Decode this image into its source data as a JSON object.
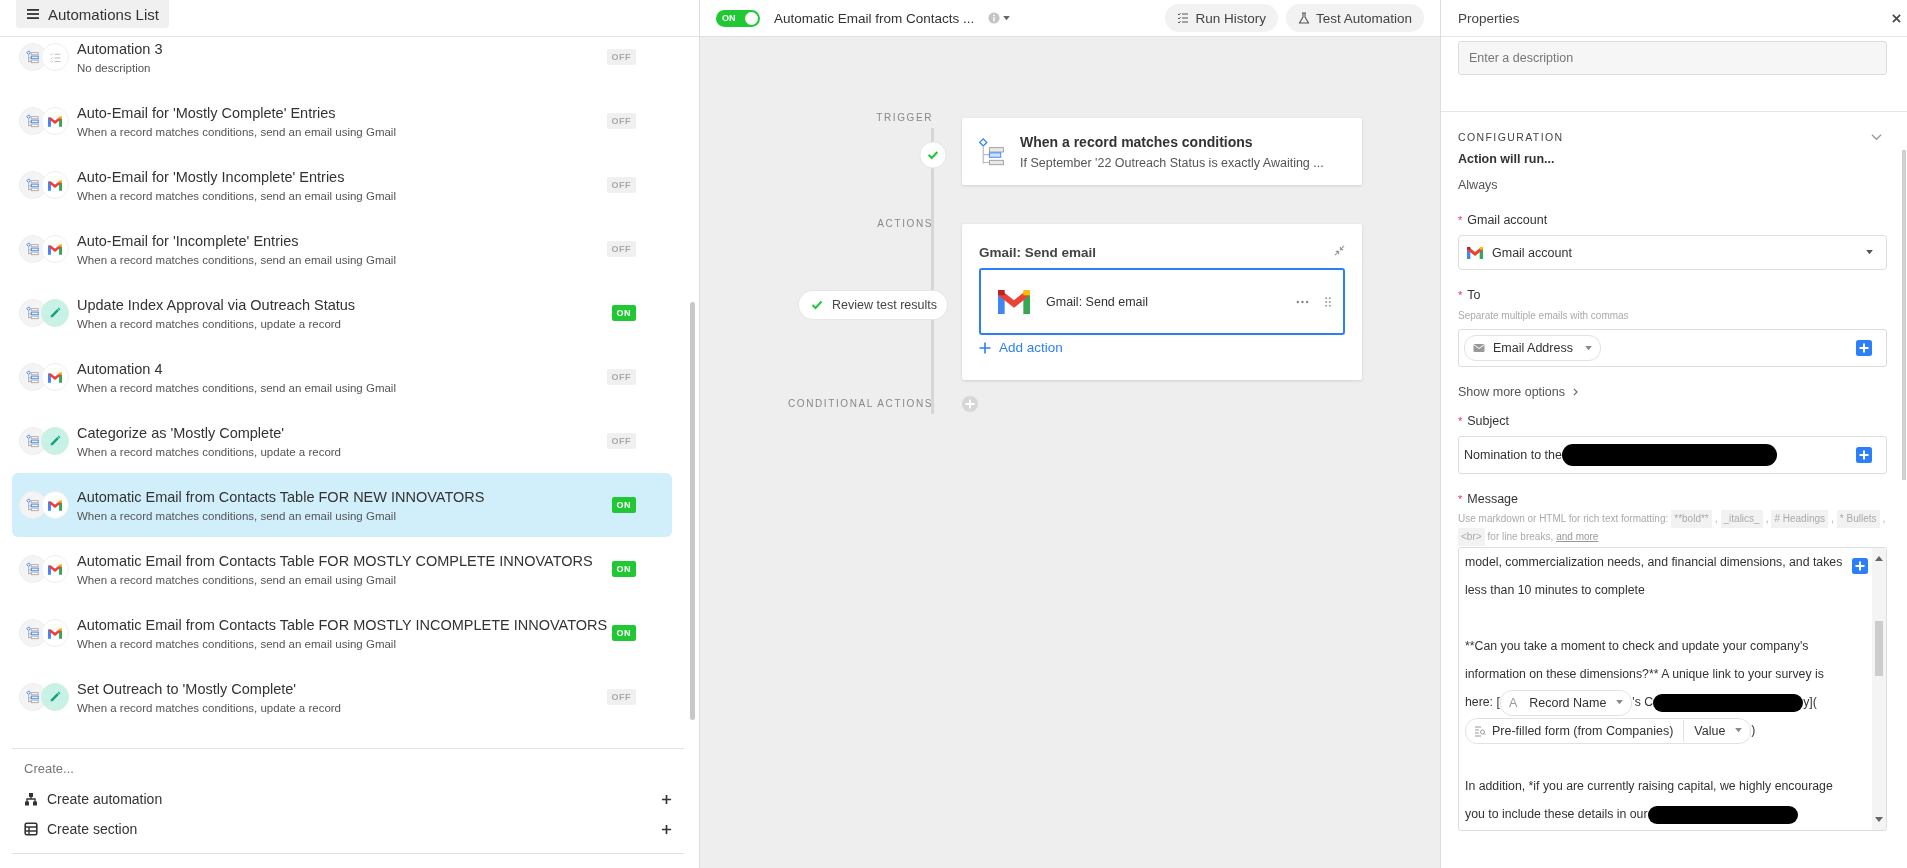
{
  "list_panel": {
    "title": "Automations List",
    "automations": [
      {
        "name": "Automation 3",
        "description": "No description",
        "kind": "none",
        "status": "OFF",
        "on": false,
        "selected": false
      },
      {
        "name": "Auto-Email for 'Mostly Complete' Entries",
        "description": "When a record matches conditions, send an email using Gmail",
        "kind": "gmail",
        "status": "OFF",
        "on": false,
        "selected": false
      },
      {
        "name": "Auto-Email for 'Mostly Incomplete' Entries",
        "description": "When a record matches conditions, send an email using Gmail",
        "kind": "gmail",
        "status": "OFF",
        "on": false,
        "selected": false
      },
      {
        "name": "Auto-Email for 'Incomplete' Entries",
        "description": "When a record matches conditions, send an email using Gmail",
        "kind": "gmail",
        "status": "OFF",
        "on": false,
        "selected": false
      },
      {
        "name": "Update Index Approval via Outreach Status",
        "description": "When a record matches conditions, update a record",
        "kind": "update",
        "status": "ON",
        "on": true,
        "selected": false
      },
      {
        "name": "Automation 4",
        "description": "When a record matches conditions, send an email using Gmail",
        "kind": "gmail",
        "status": "OFF",
        "on": false,
        "selected": false
      },
      {
        "name": "Categorize as 'Mostly Complete'",
        "description": "When a record matches conditions, update a record",
        "kind": "update",
        "status": "OFF",
        "on": false,
        "selected": false
      },
      {
        "name": "Automatic Email from Contacts Table FOR NEW INNOVATORS",
        "description": "When a record matches conditions, send an email using Gmail",
        "kind": "gmail",
        "status": "ON",
        "on": true,
        "selected": true
      },
      {
        "name": "Automatic Email from Contacts Table FOR MOSTLY COMPLETE INNOVATORS",
        "description": "When a record matches conditions, send an email using Gmail",
        "kind": "gmail",
        "status": "ON",
        "on": true,
        "selected": false
      },
      {
        "name": "Automatic Email from Contacts Table FOR MOSTLY INCOMPLETE INNOVATORS",
        "description": "When a record matches conditions, send an email using Gmail",
        "kind": "gmail",
        "status": "ON",
        "on": true,
        "selected": false
      },
      {
        "name": "Set Outreach to 'Mostly Complete'",
        "description": "When a record matches conditions, update a record",
        "kind": "update",
        "status": "OFF",
        "on": false,
        "selected": false
      }
    ],
    "create": {
      "heading": "Create...",
      "items": [
        {
          "kind": "automation",
          "label": "Create automation"
        },
        {
          "kind": "section",
          "label": "Create section"
        }
      ]
    }
  },
  "toolbar": {
    "toggle_label": "ON",
    "on": true,
    "title": "Automatic Email from Contacts ...",
    "buttons": [
      {
        "kind": "history",
        "label": "Run History"
      },
      {
        "kind": "test",
        "label": "Test Automation"
      }
    ]
  },
  "flow": {
    "trigger_label": "TRIGGER",
    "trigger": {
      "title": "When a record matches conditions",
      "subtitle": "If September '22 Outreach Status is exactly Awaiting ..."
    },
    "actions_label": "ACTIONS",
    "review_label": "Review test results",
    "action_group": {
      "title": "Gmail: Send email",
      "action": {
        "label": "Gmail: Send email",
        "selected": true
      },
      "add_label": "Add action"
    },
    "conditional_label": "CONDITIONAL ACTIONS"
  },
  "properties": {
    "title": "Properties",
    "description_placeholder": "Enter a description",
    "section_title": "CONFIGURATION",
    "run_label": "Action will run...",
    "run_value": "Always",
    "gmail_account": {
      "required_mark": "*",
      "label": "Gmail account",
      "value": "Gmail account"
    },
    "to": {
      "required_mark": "*",
      "label": "To",
      "hint": "Separate multiple emails with commas",
      "token": "Email Address"
    },
    "show_more": "Show more options",
    "subject": {
      "required_mark": "*",
      "label": "Subject",
      "value": "Nomination to the",
      "redacted": true
    },
    "message": {
      "required_mark": "*",
      "label": "Message",
      "hint": [
        {
          "kind": "text",
          "text": "Use markdown or HTML for rich text formatting:"
        },
        {
          "kind": "code",
          "text": "**bold**"
        },
        {
          "kind": "text",
          "text": ","
        },
        {
          "kind": "code",
          "text": "_italics_"
        },
        {
          "kind": "text",
          "text": ","
        },
        {
          "kind": "code",
          "text": "# Headings"
        },
        {
          "kind": "text",
          "text": ","
        },
        {
          "kind": "code",
          "text": "* Bullets"
        },
        {
          "kind": "text",
          "text": ","
        },
        {
          "kind": "code",
          "text": "<br>"
        },
        {
          "kind": "text",
          "text": "for line breaks,"
        },
        {
          "kind": "link",
          "text": "and more"
        }
      ],
      "body": [
        [
          {
            "kind": "line",
            "text": "model, commercialization needs, and financial dimensions, and takes"
          },
          {
            "kind": "line",
            "text": "less than 10 minutes to complete"
          }
        ],
        [
          {
            "kind": "line",
            "text": "**Can you take a moment to check and update your company's"
          },
          {
            "kind": "line",
            "text": "information on these dimensions?** A unique link to your survey is"
          },
          {
            "kind": "text",
            "text": "here: ["
          },
          {
            "kind": "field",
            "glyph": "A",
            "label": "Record Name"
          },
          {
            "kind": "text",
            "text": "'s C"
          },
          {
            "kind": "redaction"
          },
          {
            "kind": "text",
            "text": "y]("
          },
          {
            "kind": "lookup",
            "label": "Pre-filled form (from Companies)",
            "value": "Value"
          },
          {
            "kind": "text",
            "text": ")"
          }
        ],
        [
          {
            "kind": "line",
            "text": "In addition, *if you are currently raising capital, we highly encourage"
          },
          {
            "kind": "text",
            "text": "you to include these details in our"
          },
          {
            "kind": "redaction"
          }
        ]
      ]
    }
  }
}
